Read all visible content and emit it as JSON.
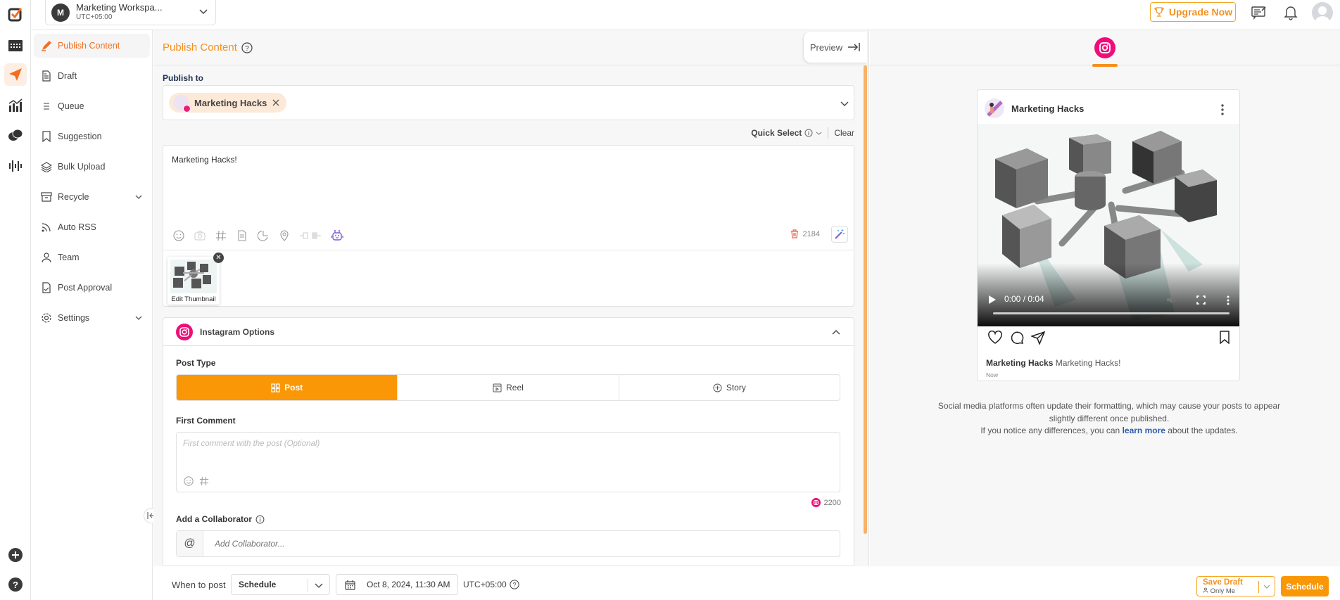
{
  "workspace": {
    "initial": "M",
    "name": "Marketing Workspa...",
    "timezone": "UTC+05:00"
  },
  "topbar": {
    "upgrade_label": "Upgrade Now"
  },
  "rail": {
    "icons": [
      "logo-icon",
      "calendar-icon",
      "publish-icon",
      "analytics-icon",
      "inbox-icon",
      "listening-icon"
    ],
    "bottom": [
      "add-icon",
      "help-icon"
    ]
  },
  "sidebar": {
    "items": [
      {
        "label": "Publish Content",
        "icon": "pencil-icon",
        "active": true
      },
      {
        "label": "Draft",
        "icon": "document-icon"
      },
      {
        "label": "Queue",
        "icon": "list-icon"
      },
      {
        "label": "Suggestion",
        "icon": "bookmark-icon"
      },
      {
        "label": "Bulk Upload",
        "icon": "layers-icon"
      },
      {
        "label": "Recycle",
        "icon": "archive-icon",
        "expandable": true
      },
      {
        "label": "Auto RSS",
        "icon": "rss-icon"
      },
      {
        "label": "Team",
        "icon": "user-icon"
      },
      {
        "label": "Post Approval",
        "icon": "approval-icon"
      },
      {
        "label": "Settings",
        "icon": "gear-icon",
        "expandable": true
      }
    ]
  },
  "main": {
    "title": "Publish Content",
    "preview_label": "Preview",
    "publish_to_label": "Publish to",
    "selected_account": "Marketing Hacks",
    "quick_select_label": "Quick Select",
    "clear_label": "Clear",
    "post_text": "Marketing Hacks!",
    "char_count": "2184",
    "thumbnail_label": "Edit Thumbnail",
    "instagram": {
      "title": "Instagram Options",
      "post_type_label": "Post Type",
      "post_types": [
        {
          "label": "Post",
          "selected": true
        },
        {
          "label": "Reel"
        },
        {
          "label": "Story"
        }
      ],
      "first_comment_label": "First Comment",
      "first_comment_placeholder": "First comment with the post (Optional)",
      "comment_char_count": "2200",
      "collaborator_label": "Add a Collaborator",
      "collaborator_placeholder": "Add Collaborator..."
    }
  },
  "bottom": {
    "when_label": "When to post",
    "schedule_option": "Schedule",
    "date": "Oct 8, 2024, 11:30 AM",
    "timezone": "UTC+05:00",
    "save_draft_label": "Save Draft",
    "save_draft_sub": "Only Me",
    "schedule_label": "Schedule"
  },
  "preview": {
    "account": "Marketing Hacks",
    "video_time": "0:00 / 0:04",
    "caption_account": "Marketing Hacks",
    "caption_text": "Marketing Hacks!",
    "timestamp": "Now",
    "note_line1": "Social media platforms often update their formatting, which may cause your posts to appear slightly different once published.",
    "note_line2_pre": "If you notice any differences, you can ",
    "note_link": "learn more",
    "note_line2_post": " about the updates."
  },
  "colors": {
    "accent": "#fa9707",
    "brand_orange": "#f26f21",
    "instagram": "#ef0d7a",
    "link": "#2c5da8"
  }
}
